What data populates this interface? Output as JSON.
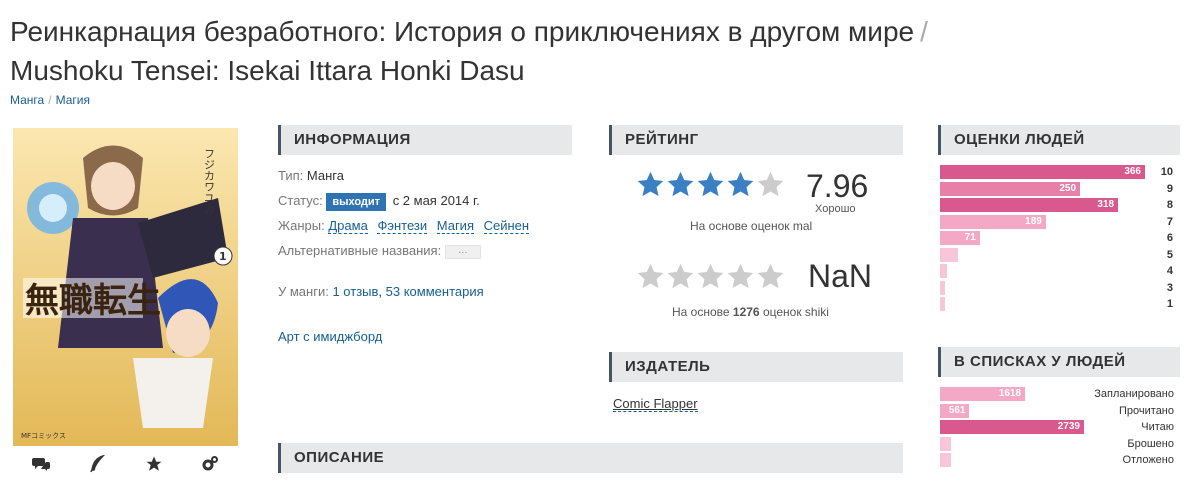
{
  "title": {
    "ru": "Реинкарнация безработного: История о приключениях в другом мире",
    "separator": "/",
    "romaji": "Mushoku Tensei: Isekai Ittara Honki Dasu"
  },
  "breadcrumbs": [
    "Манга",
    "Магия"
  ],
  "poster": {
    "cover_title_jp": "無職転生",
    "author_jp": "フジカワユカ",
    "volume": "1",
    "publisher_mark": "MFコミックス"
  },
  "info": {
    "header": "ИНФОРМАЦИЯ",
    "type_label": "Тип:",
    "type_value": "Манга",
    "status_label": "Статус:",
    "status_badge": "выходит",
    "status_date": "с 2 мая 2014 г.",
    "genres_label": "Жанры:",
    "genres": [
      "Драма",
      "Фэнтези",
      "Магия",
      "Сейнен"
    ],
    "alt_names_label": "Альтернативные названия:",
    "alt_names_button": "…",
    "manga_label": "У манги:",
    "reviews_link": "1 отзыв",
    "comments_link": "53 комментария",
    "art_link": "Арт с имиджборд"
  },
  "rating": {
    "header": "РЕЙТИНГ",
    "mal_score": "7.96",
    "mal_stars": 4,
    "mal_word": "Хорошо",
    "mal_note": "На основе оценок mal",
    "shiki_score": "NaN",
    "shiki_stars": 0,
    "shiki_note_prefix": "На основе",
    "shiki_count": "1276",
    "shiki_note_suffix": "оценок shiki"
  },
  "publisher": {
    "header": "ИЗДАТЕЛЬ",
    "name": "Comic Flapper"
  },
  "description": {
    "header": "ОПИСАНИЕ"
  },
  "scores": {
    "header": "ОЦЕНКИ ЛЮДЕЙ",
    "rows": [
      {
        "label": "10",
        "value": 366,
        "text": "366",
        "color": "#d9588e"
      },
      {
        "label": "9",
        "value": 250,
        "text": "250",
        "color": "#e77fa9"
      },
      {
        "label": "8",
        "value": 318,
        "text": "318",
        "color": "#d9588e"
      },
      {
        "label": "7",
        "value": 189,
        "text": "189",
        "color": "#f5a8c5"
      },
      {
        "label": "6",
        "value": 71,
        "text": "71",
        "color": "#f5a8c5"
      },
      {
        "label": "5",
        "value": 33,
        "text": "",
        "color": "#f9c6d9"
      },
      {
        "label": "4",
        "value": 12,
        "text": "",
        "color": "#f9c6d9"
      },
      {
        "label": "3",
        "value": 9,
        "text": "",
        "color": "#f9c6d9"
      },
      {
        "label": "1",
        "value": 9,
        "text": "",
        "color": "#f9c6d9"
      }
    ]
  },
  "lists": {
    "header": "В СПИСКАХ У ЛЮДЕЙ",
    "rows": [
      {
        "label": "Запланировано",
        "value": 1618,
        "text": "1618",
        "color": "#f5a8c5"
      },
      {
        "label": "Прочитано",
        "value": 561,
        "text": "561",
        "color": "#f5a8c5"
      },
      {
        "label": "Читаю",
        "value": 2739,
        "text": "2739",
        "color": "#d9588e"
      },
      {
        "label": "Брошено",
        "value": 200,
        "text": "",
        "color": "#f9c6d9"
      },
      {
        "label": "Отложено",
        "value": 200,
        "text": "",
        "color": "#f9c6d9"
      }
    ]
  },
  "colors": {
    "link": "#176093",
    "star_on": "#3b7fc4",
    "star_off": "#cccccc",
    "badge": "#2f73b3"
  }
}
